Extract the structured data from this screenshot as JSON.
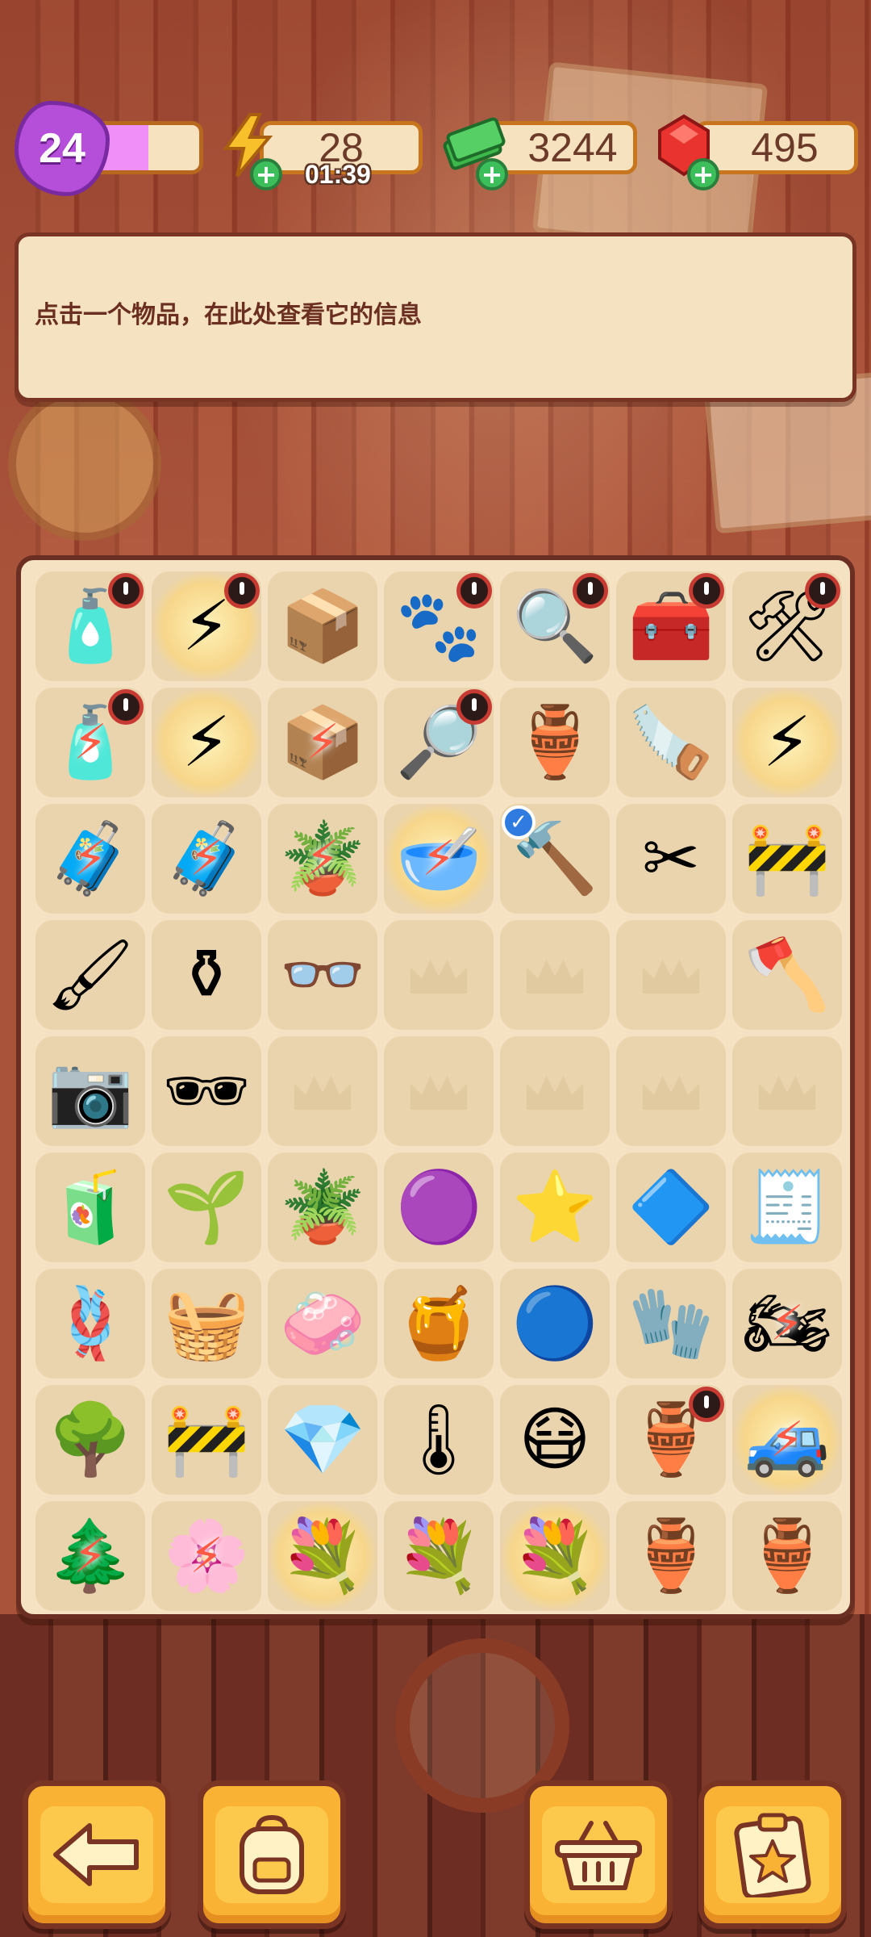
{
  "hud": {
    "level": "24",
    "xp_progress": 0.52,
    "energy": "28",
    "energy_timer": "01:39",
    "cash": "3244",
    "gems": "495",
    "icons": {
      "energy": "lightning-icon",
      "cash": "cash-stack-icon",
      "gems": "ruby-icon",
      "plus": "plus-icon"
    }
  },
  "info_panel": {
    "text": "点击一个物品，在此处查看它的信息"
  },
  "board": {
    "rows": [
      [
        {
          "name": "first-aid-kit-item",
          "glyph": "🧴",
          "timer": true
        },
        {
          "name": "energy-orb-item",
          "glyph": "⚡",
          "glow": true,
          "timer": true
        },
        {
          "name": "wooden-crate-item",
          "glyph": "📦",
          "timer": false
        },
        {
          "name": "paw-print-case-item",
          "glyph": "🐾",
          "timer": true
        },
        {
          "name": "evidence-case-item",
          "glyph": "🔍",
          "timer": true
        },
        {
          "name": "red-toolbox-item",
          "glyph": "🧰",
          "timer": true
        },
        {
          "name": "red-machine-item",
          "glyph": "🛠",
          "timer": true
        }
      ],
      [
        {
          "name": "first-aid-kit-locked-item",
          "glyph": "🧴",
          "timer": true,
          "bolt": true
        },
        {
          "name": "energy-orb-locked-item",
          "glyph": "⚡",
          "glow": true
        },
        {
          "name": "wooden-crate-locked-item",
          "glyph": "📦",
          "bolt": true
        },
        {
          "name": "evidence-box-item",
          "glyph": "🔎",
          "timer": true
        },
        {
          "name": "clay-pot-item",
          "glyph": "🏺"
        },
        {
          "name": "hand-saw-item",
          "glyph": "🪚"
        },
        {
          "name": "energy-orb-glow-item",
          "glyph": "⚡",
          "glow": true
        }
      ],
      [
        {
          "name": "yellow-case-item",
          "glyph": "🧳",
          "bolt": true
        },
        {
          "name": "yellow-case-item",
          "glyph": "🧳",
          "bolt": true
        },
        {
          "name": "potted-plant-locked-item",
          "glyph": "🪴",
          "bolt": true
        },
        {
          "name": "orange-bowl-item",
          "glyph": "🥣",
          "glow": true,
          "bolt": true
        },
        {
          "name": "hammer-item",
          "glyph": "🔨",
          "check": true
        },
        {
          "name": "pruning-shears-item",
          "glyph": "✂"
        },
        {
          "name": "barrier-item",
          "glyph": "🚧"
        }
      ],
      [
        {
          "name": "paint-brush-item",
          "glyph": "🖌"
        },
        {
          "name": "glass-vase-item",
          "glyph": "⚱"
        },
        {
          "name": "eyeglasses-item",
          "glyph": "👓"
        },
        {
          "empty": true
        },
        {
          "empty": true
        },
        {
          "empty": true
        },
        {
          "name": "axe-item",
          "glyph": "🪓"
        }
      ],
      [
        {
          "name": "camera-item",
          "glyph": "📷"
        },
        {
          "name": "sunglasses-item",
          "glyph": "🕶"
        },
        {
          "empty": true
        },
        {
          "empty": true
        },
        {
          "empty": true
        },
        {
          "empty": true
        },
        {
          "empty": true
        }
      ],
      [
        {
          "name": "juice-bottle-item",
          "glyph": "🧃"
        },
        {
          "name": "sprout-pot-item",
          "glyph": "🌱"
        },
        {
          "name": "bonsai-pot-item",
          "glyph": "🪴"
        },
        {
          "name": "purple-blob-large-item",
          "glyph": "🟣"
        },
        {
          "name": "purple-star-item",
          "glyph": "⭐"
        },
        {
          "name": "purple-gem-item",
          "glyph": "🔷"
        },
        {
          "name": "evidence-bag-item",
          "glyph": "🧾"
        }
      ],
      [
        {
          "name": "rope-coil-item",
          "glyph": "🪢"
        },
        {
          "name": "burlap-sacks-item",
          "glyph": "🧺"
        },
        {
          "name": "shanghai-soap-item",
          "glyph": "🧼"
        },
        {
          "name": "honey-jar-item",
          "glyph": "🍯"
        },
        {
          "name": "energy-ball-item",
          "glyph": "🔵"
        },
        {
          "name": "red-gloves-item",
          "glyph": "🧤"
        },
        {
          "name": "purple-motorcycle-item",
          "glyph": "🏍",
          "bolt": true
        }
      ],
      [
        {
          "name": "fruit-tree-item",
          "glyph": "🌳"
        },
        {
          "name": "road-barrier-item",
          "glyph": "🚧"
        },
        {
          "name": "ruby-basket-item",
          "glyph": "💎"
        },
        {
          "name": "thermometer-gun-item",
          "glyph": "🌡"
        },
        {
          "name": "face-mask-item",
          "glyph": "😷"
        },
        {
          "name": "red-vase-item",
          "glyph": "🏺",
          "timer": true
        },
        {
          "name": "jeep-item",
          "glyph": "🚙",
          "glow": true,
          "bolt": true
        }
      ],
      [
        {
          "name": "small-tree-locked-item",
          "glyph": "🌲",
          "bolt": true
        },
        {
          "name": "blossom-tree-locked-item",
          "glyph": "🌸",
          "bolt": true
        },
        {
          "name": "flower-basket-item",
          "glyph": "💐",
          "glow": true
        },
        {
          "name": "flower-bouquet-item",
          "glyph": "💐"
        },
        {
          "name": "flower-basket-glow-item",
          "glyph": "💐",
          "glow": true
        },
        {
          "name": "ornate-vase-item",
          "glyph": "🏺"
        },
        {
          "name": "golden-vase-item",
          "glyph": "🏺"
        }
      ]
    ]
  },
  "bottom_bar": {
    "buttons": [
      {
        "name": "back-button",
        "icon": "arrow-left-icon",
        "glyph": "⬅"
      },
      {
        "name": "backpack-button",
        "icon": "backpack-icon",
        "glyph": "🎒"
      },
      {
        "name": "basket-button",
        "icon": "basket-icon",
        "glyph": "🧺"
      },
      {
        "name": "task-board-button",
        "icon": "clipboard-star-icon",
        "glyph": "📋"
      }
    ]
  }
}
